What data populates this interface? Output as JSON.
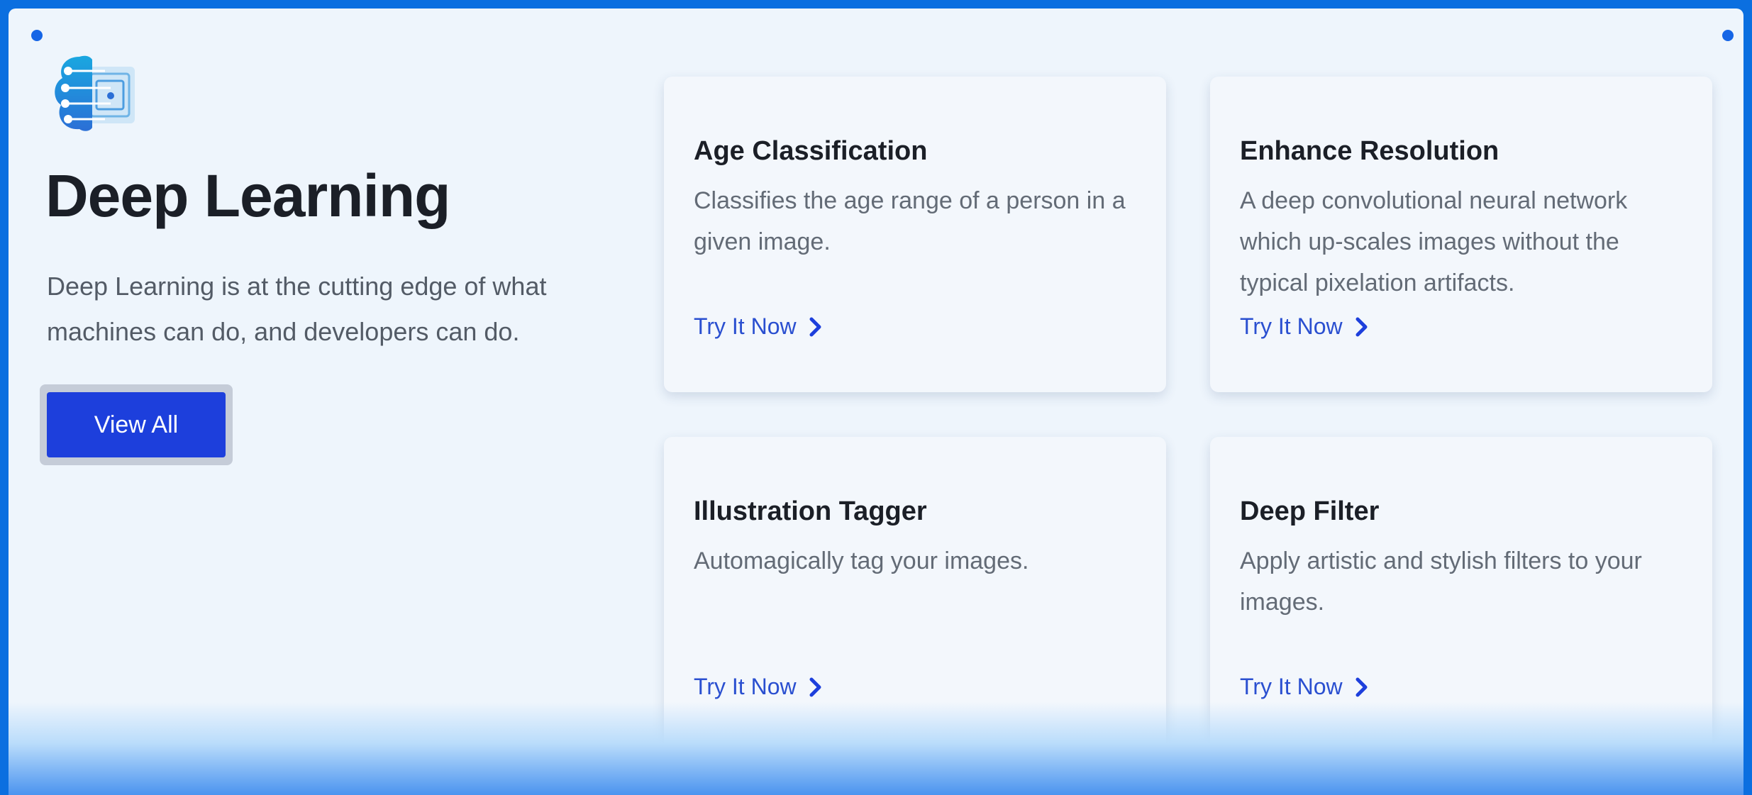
{
  "colors": {
    "frame": "#0b6fe0",
    "panel": "#eef5fc",
    "primary_button": "#1d3fdc",
    "link": "#2a4fd0"
  },
  "icons": {
    "logo": "brain-circuit-logo-icon",
    "cta": "chevron-right-icon",
    "corners": "dot-icon"
  },
  "hero": {
    "title": "Deep Learning",
    "description": "Deep Learning is at the cutting edge of what machines can do, and developers can do.",
    "button_label": "View All"
  },
  "cards": [
    {
      "title": "Age Classification",
      "description": "Classifies the age range of a person in a given image.",
      "cta": "Try It Now"
    },
    {
      "title": "Enhance Resolution",
      "description": "A deep convolutional neural network which up-scales images without the typical pixelation artifacts.",
      "cta": "Try It Now"
    },
    {
      "title": "Illustration Tagger",
      "description": "Automagically tag your images.",
      "cta": "Try It Now"
    },
    {
      "title": "Deep Filter",
      "description": "Apply artistic and stylish filters to your images.",
      "cta": "Try It Now"
    }
  ]
}
